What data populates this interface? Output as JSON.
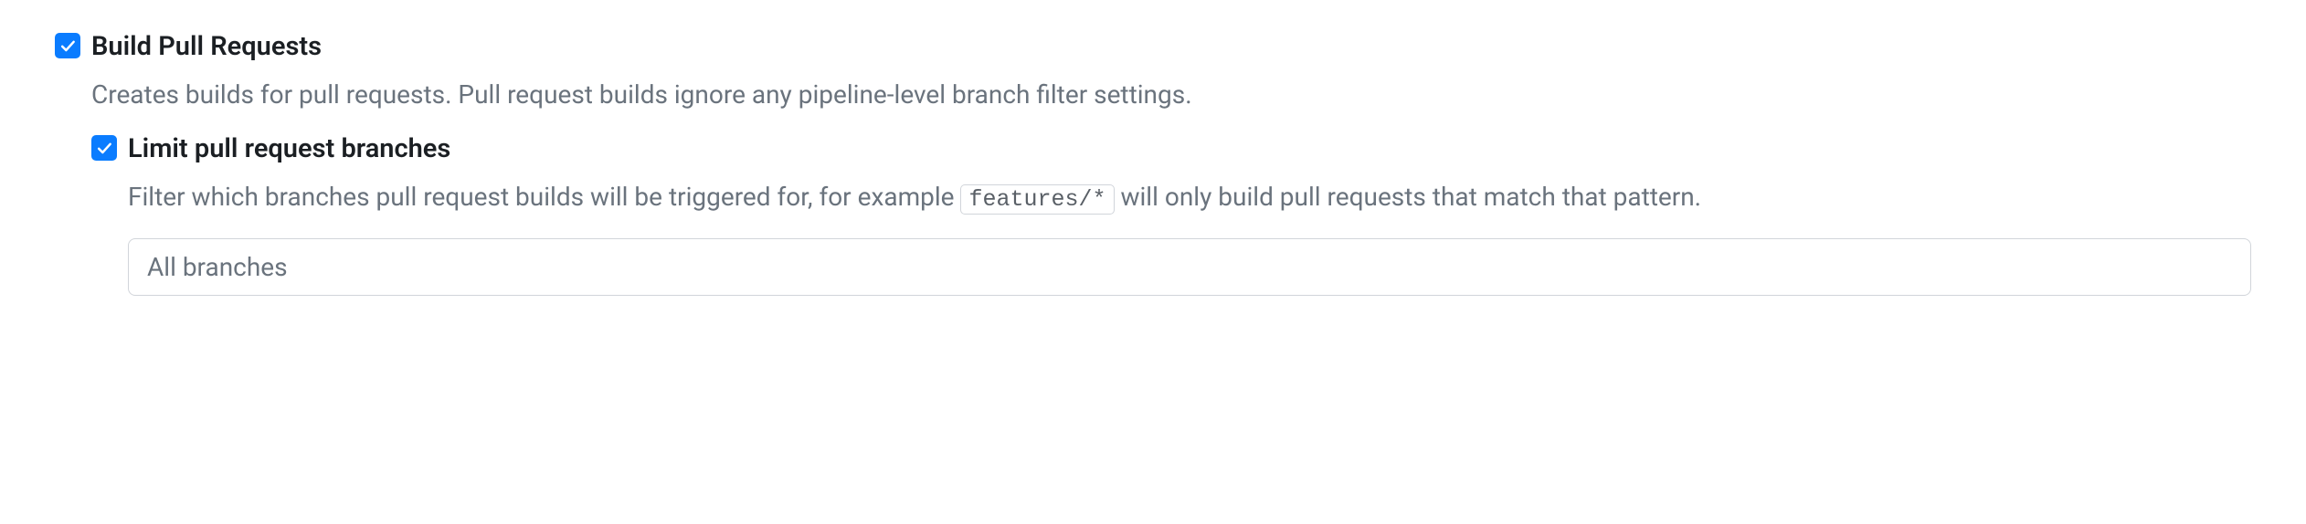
{
  "settings": {
    "build_pr": {
      "checked": true,
      "title": "Build Pull Requests",
      "description": "Creates builds for pull requests. Pull request builds ignore any pipeline-level branch filter settings."
    },
    "limit_branches": {
      "checked": true,
      "title": "Limit pull request branches",
      "description_prefix": "Filter which branches pull request builds will be triggered for, for example ",
      "code_example": "features/*",
      "description_suffix": " will only build pull requests that match that pattern.",
      "input_placeholder": "All branches",
      "input_value": ""
    }
  }
}
